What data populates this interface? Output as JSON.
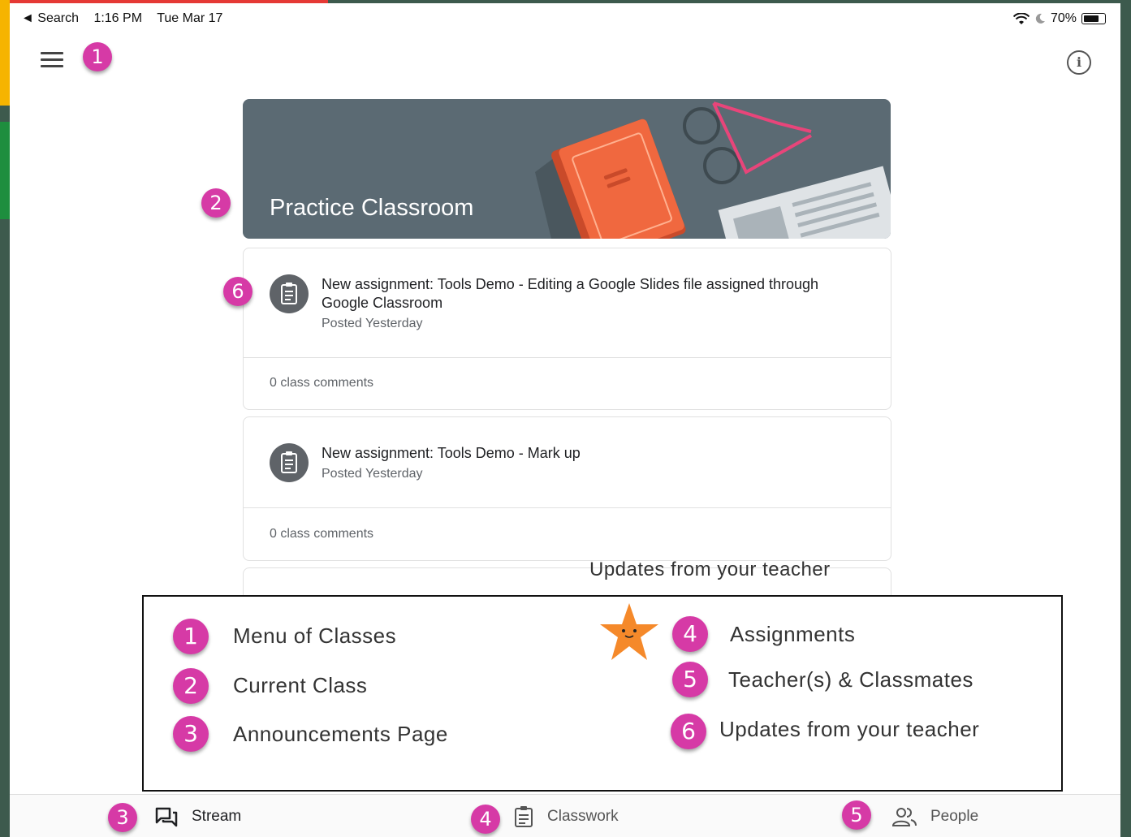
{
  "status_bar": {
    "back_label": "◄ Search",
    "time": "1:16 PM",
    "date": "Tue Mar 17",
    "battery": "70%"
  },
  "class": {
    "title": "Practice Classroom"
  },
  "posts": [
    {
      "title": "New assignment: Tools Demo - Editing a Google Slides file assigned through Google Classroom",
      "posted": "Posted Yesterday",
      "comments": "0 class comments"
    },
    {
      "title": "New assignment: Tools Demo - Mark up",
      "posted": "Posted Yesterday",
      "comments": "0 class comments"
    }
  ],
  "badges": [
    "1",
    "2",
    "3",
    "4",
    "5",
    "6"
  ],
  "legend": {
    "header": "Updates from your teacher",
    "items": [
      {
        "num": "1",
        "label": "Menu of Classes"
      },
      {
        "num": "2",
        "label": "Current Class"
      },
      {
        "num": "3",
        "label": "Announcements Page"
      },
      {
        "num": "4",
        "label": "Assignments"
      },
      {
        "num": "5",
        "label": "Teacher(s) & Classmates"
      },
      {
        "num": "6",
        "label": "Updates from your teacher"
      }
    ]
  },
  "bottom_nav": {
    "stream": "Stream",
    "classwork": "Classwork",
    "people": "People"
  },
  "icons": {
    "menu": "hamburger-menu-icon",
    "info": "info-icon",
    "assignment": "assignment-icon",
    "stream": "stream-icon",
    "classwork": "classwork-icon",
    "people": "people-icon",
    "star": "star-icon"
  },
  "colors": {
    "badge": "#d63aa6",
    "banner": "#5b6a73",
    "star": "#f5892a"
  }
}
